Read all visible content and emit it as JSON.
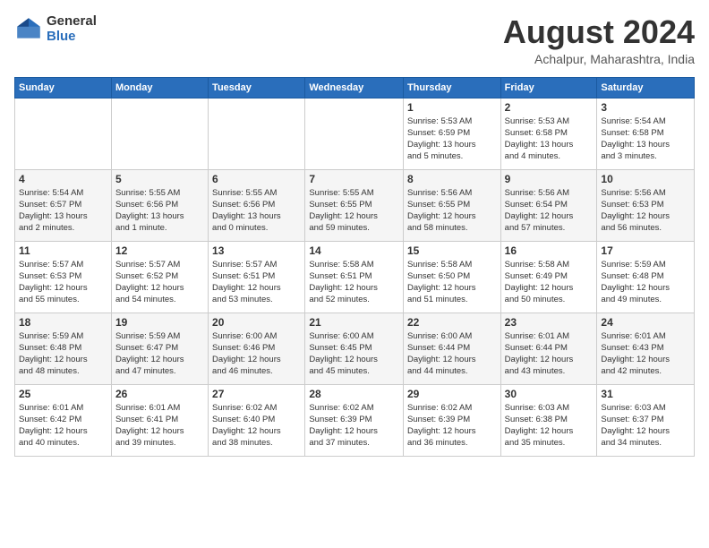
{
  "header": {
    "logo_general": "General",
    "logo_blue": "Blue",
    "month_year": "August 2024",
    "location": "Achalpur, Maharashtra, India"
  },
  "days_of_week": [
    "Sunday",
    "Monday",
    "Tuesday",
    "Wednesday",
    "Thursday",
    "Friday",
    "Saturday"
  ],
  "weeks": [
    [
      {
        "day": "",
        "info": ""
      },
      {
        "day": "",
        "info": ""
      },
      {
        "day": "",
        "info": ""
      },
      {
        "day": "",
        "info": ""
      },
      {
        "day": "1",
        "info": "Sunrise: 5:53 AM\nSunset: 6:59 PM\nDaylight: 13 hours\nand 5 minutes."
      },
      {
        "day": "2",
        "info": "Sunrise: 5:53 AM\nSunset: 6:58 PM\nDaylight: 13 hours\nand 4 minutes."
      },
      {
        "day": "3",
        "info": "Sunrise: 5:54 AM\nSunset: 6:58 PM\nDaylight: 13 hours\nand 3 minutes."
      }
    ],
    [
      {
        "day": "4",
        "info": "Sunrise: 5:54 AM\nSunset: 6:57 PM\nDaylight: 13 hours\nand 2 minutes."
      },
      {
        "day": "5",
        "info": "Sunrise: 5:55 AM\nSunset: 6:56 PM\nDaylight: 13 hours\nand 1 minute."
      },
      {
        "day": "6",
        "info": "Sunrise: 5:55 AM\nSunset: 6:56 PM\nDaylight: 13 hours\nand 0 minutes."
      },
      {
        "day": "7",
        "info": "Sunrise: 5:55 AM\nSunset: 6:55 PM\nDaylight: 12 hours\nand 59 minutes."
      },
      {
        "day": "8",
        "info": "Sunrise: 5:56 AM\nSunset: 6:55 PM\nDaylight: 12 hours\nand 58 minutes."
      },
      {
        "day": "9",
        "info": "Sunrise: 5:56 AM\nSunset: 6:54 PM\nDaylight: 12 hours\nand 57 minutes."
      },
      {
        "day": "10",
        "info": "Sunrise: 5:56 AM\nSunset: 6:53 PM\nDaylight: 12 hours\nand 56 minutes."
      }
    ],
    [
      {
        "day": "11",
        "info": "Sunrise: 5:57 AM\nSunset: 6:53 PM\nDaylight: 12 hours\nand 55 minutes."
      },
      {
        "day": "12",
        "info": "Sunrise: 5:57 AM\nSunset: 6:52 PM\nDaylight: 12 hours\nand 54 minutes."
      },
      {
        "day": "13",
        "info": "Sunrise: 5:57 AM\nSunset: 6:51 PM\nDaylight: 12 hours\nand 53 minutes."
      },
      {
        "day": "14",
        "info": "Sunrise: 5:58 AM\nSunset: 6:51 PM\nDaylight: 12 hours\nand 52 minutes."
      },
      {
        "day": "15",
        "info": "Sunrise: 5:58 AM\nSunset: 6:50 PM\nDaylight: 12 hours\nand 51 minutes."
      },
      {
        "day": "16",
        "info": "Sunrise: 5:58 AM\nSunset: 6:49 PM\nDaylight: 12 hours\nand 50 minutes."
      },
      {
        "day": "17",
        "info": "Sunrise: 5:59 AM\nSunset: 6:48 PM\nDaylight: 12 hours\nand 49 minutes."
      }
    ],
    [
      {
        "day": "18",
        "info": "Sunrise: 5:59 AM\nSunset: 6:48 PM\nDaylight: 12 hours\nand 48 minutes."
      },
      {
        "day": "19",
        "info": "Sunrise: 5:59 AM\nSunset: 6:47 PM\nDaylight: 12 hours\nand 47 minutes."
      },
      {
        "day": "20",
        "info": "Sunrise: 6:00 AM\nSunset: 6:46 PM\nDaylight: 12 hours\nand 46 minutes."
      },
      {
        "day": "21",
        "info": "Sunrise: 6:00 AM\nSunset: 6:45 PM\nDaylight: 12 hours\nand 45 minutes."
      },
      {
        "day": "22",
        "info": "Sunrise: 6:00 AM\nSunset: 6:44 PM\nDaylight: 12 hours\nand 44 minutes."
      },
      {
        "day": "23",
        "info": "Sunrise: 6:01 AM\nSunset: 6:44 PM\nDaylight: 12 hours\nand 43 minutes."
      },
      {
        "day": "24",
        "info": "Sunrise: 6:01 AM\nSunset: 6:43 PM\nDaylight: 12 hours\nand 42 minutes."
      }
    ],
    [
      {
        "day": "25",
        "info": "Sunrise: 6:01 AM\nSunset: 6:42 PM\nDaylight: 12 hours\nand 40 minutes."
      },
      {
        "day": "26",
        "info": "Sunrise: 6:01 AM\nSunset: 6:41 PM\nDaylight: 12 hours\nand 39 minutes."
      },
      {
        "day": "27",
        "info": "Sunrise: 6:02 AM\nSunset: 6:40 PM\nDaylight: 12 hours\nand 38 minutes."
      },
      {
        "day": "28",
        "info": "Sunrise: 6:02 AM\nSunset: 6:39 PM\nDaylight: 12 hours\nand 37 minutes."
      },
      {
        "day": "29",
        "info": "Sunrise: 6:02 AM\nSunset: 6:39 PM\nDaylight: 12 hours\nand 36 minutes."
      },
      {
        "day": "30",
        "info": "Sunrise: 6:03 AM\nSunset: 6:38 PM\nDaylight: 12 hours\nand 35 minutes."
      },
      {
        "day": "31",
        "info": "Sunrise: 6:03 AM\nSunset: 6:37 PM\nDaylight: 12 hours\nand 34 minutes."
      }
    ]
  ]
}
